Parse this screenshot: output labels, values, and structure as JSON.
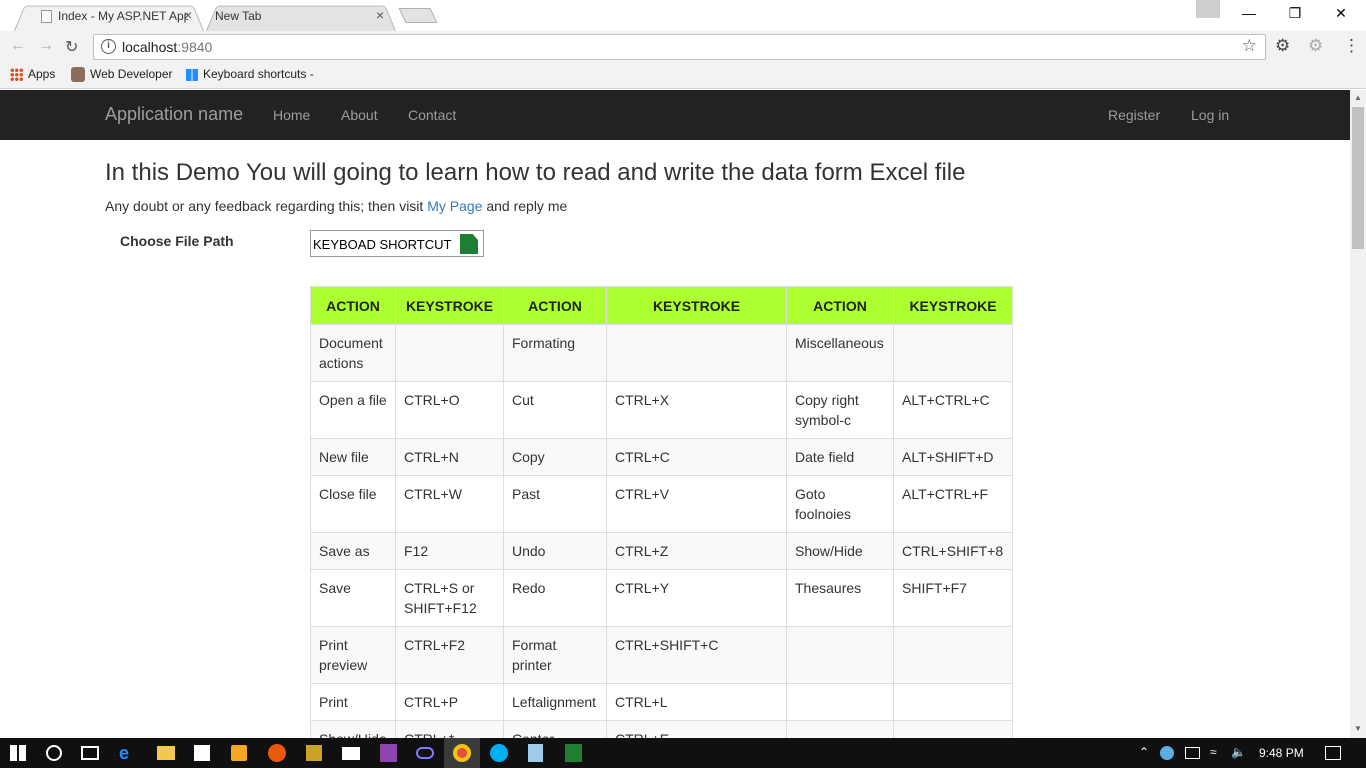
{
  "browser": {
    "tabs": [
      {
        "title": "Index - My ASP.NET Appl",
        "close": "×"
      },
      {
        "title": "New Tab",
        "close": "×"
      }
    ],
    "url_host": "localhost",
    "url_port": ":9840",
    "info_glyph": "i",
    "bookmarks": [
      "Apps",
      "Web Developer",
      "Keyboard shortcuts -"
    ]
  },
  "navbar": {
    "brand": "Application name",
    "links": [
      "Home",
      "About",
      "Contact"
    ],
    "right_links": [
      "Register",
      "Log in"
    ]
  },
  "page": {
    "heading": "In this Demo You will going to learn how to read and write the data form Excel file",
    "intro_before": "Any doubt or any feedback regarding this; then visit ",
    "intro_link": "My Page",
    "intro_after": " and reply me",
    "choose_label": "Choose File Path",
    "file_value": "KEYBOAD SHORTCUT"
  },
  "table": {
    "headers": [
      "ACTION",
      "KEYSTROKE",
      "ACTION",
      "KEYSTROKE",
      "ACTION",
      "KEYSTROKE"
    ],
    "rows": [
      [
        "Document actions",
        "",
        "Formating",
        "",
        "Miscellaneous",
        ""
      ],
      [
        "Open a file",
        "CTRL+O",
        "Cut",
        "CTRL+X",
        "Copy right symbol-c",
        "ALT+CTRL+C"
      ],
      [
        "New file",
        "CTRL+N",
        "Copy",
        "CTRL+C",
        "Date field",
        "ALT+SHIFT+D"
      ],
      [
        "Close file",
        "CTRL+W",
        "Past",
        "CTRL+V",
        "Goto foolnoies",
        "ALT+CTRL+F"
      ],
      [
        "Save as",
        "F12",
        "Undo",
        "CTRL+Z",
        "Show/Hide",
        "CTRL+SHIFT+8"
      ],
      [
        "Save",
        "CTRL+S or SHIFT+F12",
        "Redo",
        "CTRL+Y",
        "Thesaures",
        "SHIFT+F7"
      ],
      [
        "Print preview",
        "CTRL+F2",
        "Format printer",
        "CTRL+SHIFT+C",
        "",
        ""
      ],
      [
        "Print",
        "CTRL+P",
        "Leftalignment",
        "CTRL+L",
        "",
        ""
      ],
      [
        "Show/Hide",
        "CTRL+*",
        "Center",
        "CTRL+E",
        "",
        ""
      ]
    ]
  },
  "taskbar": {
    "clock": "9:48 PM"
  },
  "colors": {
    "navbar_bg": "#222222",
    "header_bg": "#adff2f",
    "link": "#337ab7"
  }
}
